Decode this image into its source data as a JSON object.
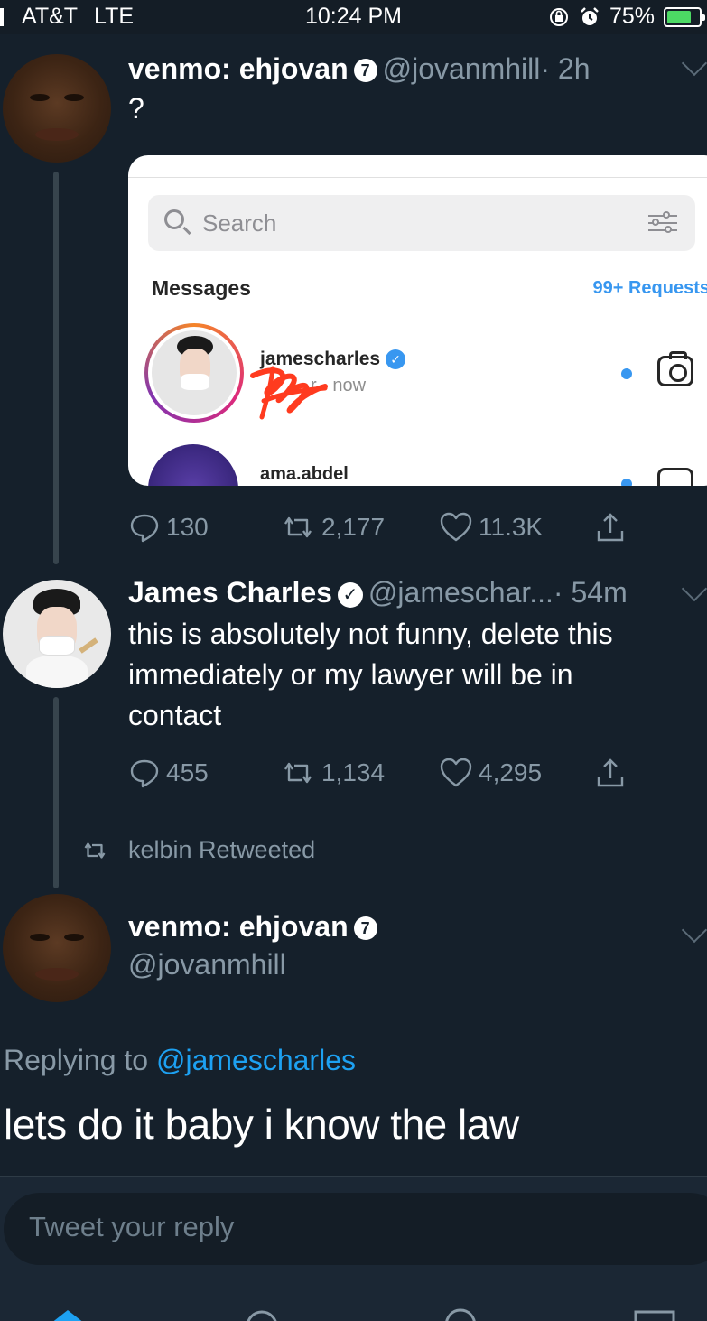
{
  "status_bar": {
    "carrier": "AT&T",
    "network": "LTE",
    "time": "10:24 PM",
    "battery": "75%",
    "battery_level": 0.75,
    "icons": [
      "signal-icon",
      "orientation-lock-icon",
      "alarm-icon",
      "battery-icon"
    ]
  },
  "tweets": [
    {
      "name": "venmo: ehjovan",
      "badge": "7",
      "handle": "@jovanmhill",
      "time": "· 2h",
      "text": "?",
      "embedded_screenshot": {
        "search_placeholder": "Search",
        "section_title": "Messages",
        "requests": "99+ Requests",
        "threads": [
          {
            "username": "jamescharles",
            "subtitle_suffix": "r · now",
            "partial_prefix": ""
          },
          {
            "username": "ama.abdel"
          }
        ]
      },
      "actions": {
        "replies": "130",
        "retweets": "2,177",
        "likes": "11.3K"
      }
    },
    {
      "name": "James Charles",
      "handle": "@jameschar...",
      "time": "· 54m",
      "text_lines": [
        "this is absolutely not funny, delete this",
        "immediately or my lawyer will be in",
        "contact"
      ],
      "actions": {
        "replies": "455",
        "retweets": "1,134",
        "likes": "4,295"
      }
    }
  ],
  "retweet_notice": "kelbin Retweeted",
  "focused_tweet": {
    "name": "venmo: ehjovan",
    "badge": "7",
    "handle": "@jovanmhill",
    "replying_prefix": "Replying to",
    "replying_mention": "@jamescharles",
    "text": "lets do it baby i know the law"
  },
  "reply_bar": {
    "placeholder": "Tweet your reply"
  },
  "colors": {
    "background": "#15202b",
    "link": "#1da1f2",
    "muted": "#8899a6",
    "instagram_blue": "#3897f0"
  }
}
